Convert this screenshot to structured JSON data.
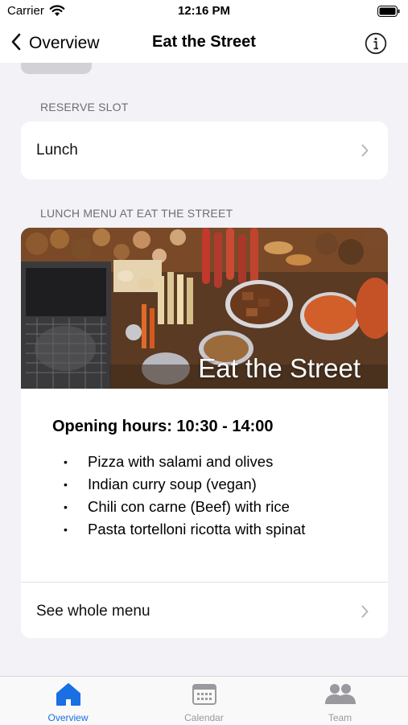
{
  "status_bar": {
    "carrier": "Carrier",
    "time": "12:16 PM"
  },
  "nav": {
    "back_label": "Overview",
    "title": "Eat the Street",
    "info_icon": "info-circle-icon"
  },
  "reserve": {
    "header": "RESERVE SLOT",
    "option": "Lunch"
  },
  "lunch_menu": {
    "header": "LUNCH MENU AT EAT THE STREET",
    "image_title": "Eat the Street",
    "opening_hours": "Opening hours: 10:30 - 14:00",
    "items": [
      "Pizza with salami and olives",
      "Indian curry soup (vegan)",
      "Chili con carne (Beef) with rice",
      "Pasta tortelloni ricotta with spinat"
    ],
    "bullet": "•",
    "see_menu": "See whole menu"
  },
  "tabs": [
    {
      "label": "Overview",
      "icon": "home-icon",
      "active": true
    },
    {
      "label": "Calendar",
      "icon": "calendar-icon",
      "active": false
    },
    {
      "label": "Team",
      "icon": "team-icon",
      "active": false
    }
  ],
  "colors": {
    "accent": "#1a6fe3",
    "inactive": "#9a9a9e",
    "background": "#f2f2f7"
  }
}
